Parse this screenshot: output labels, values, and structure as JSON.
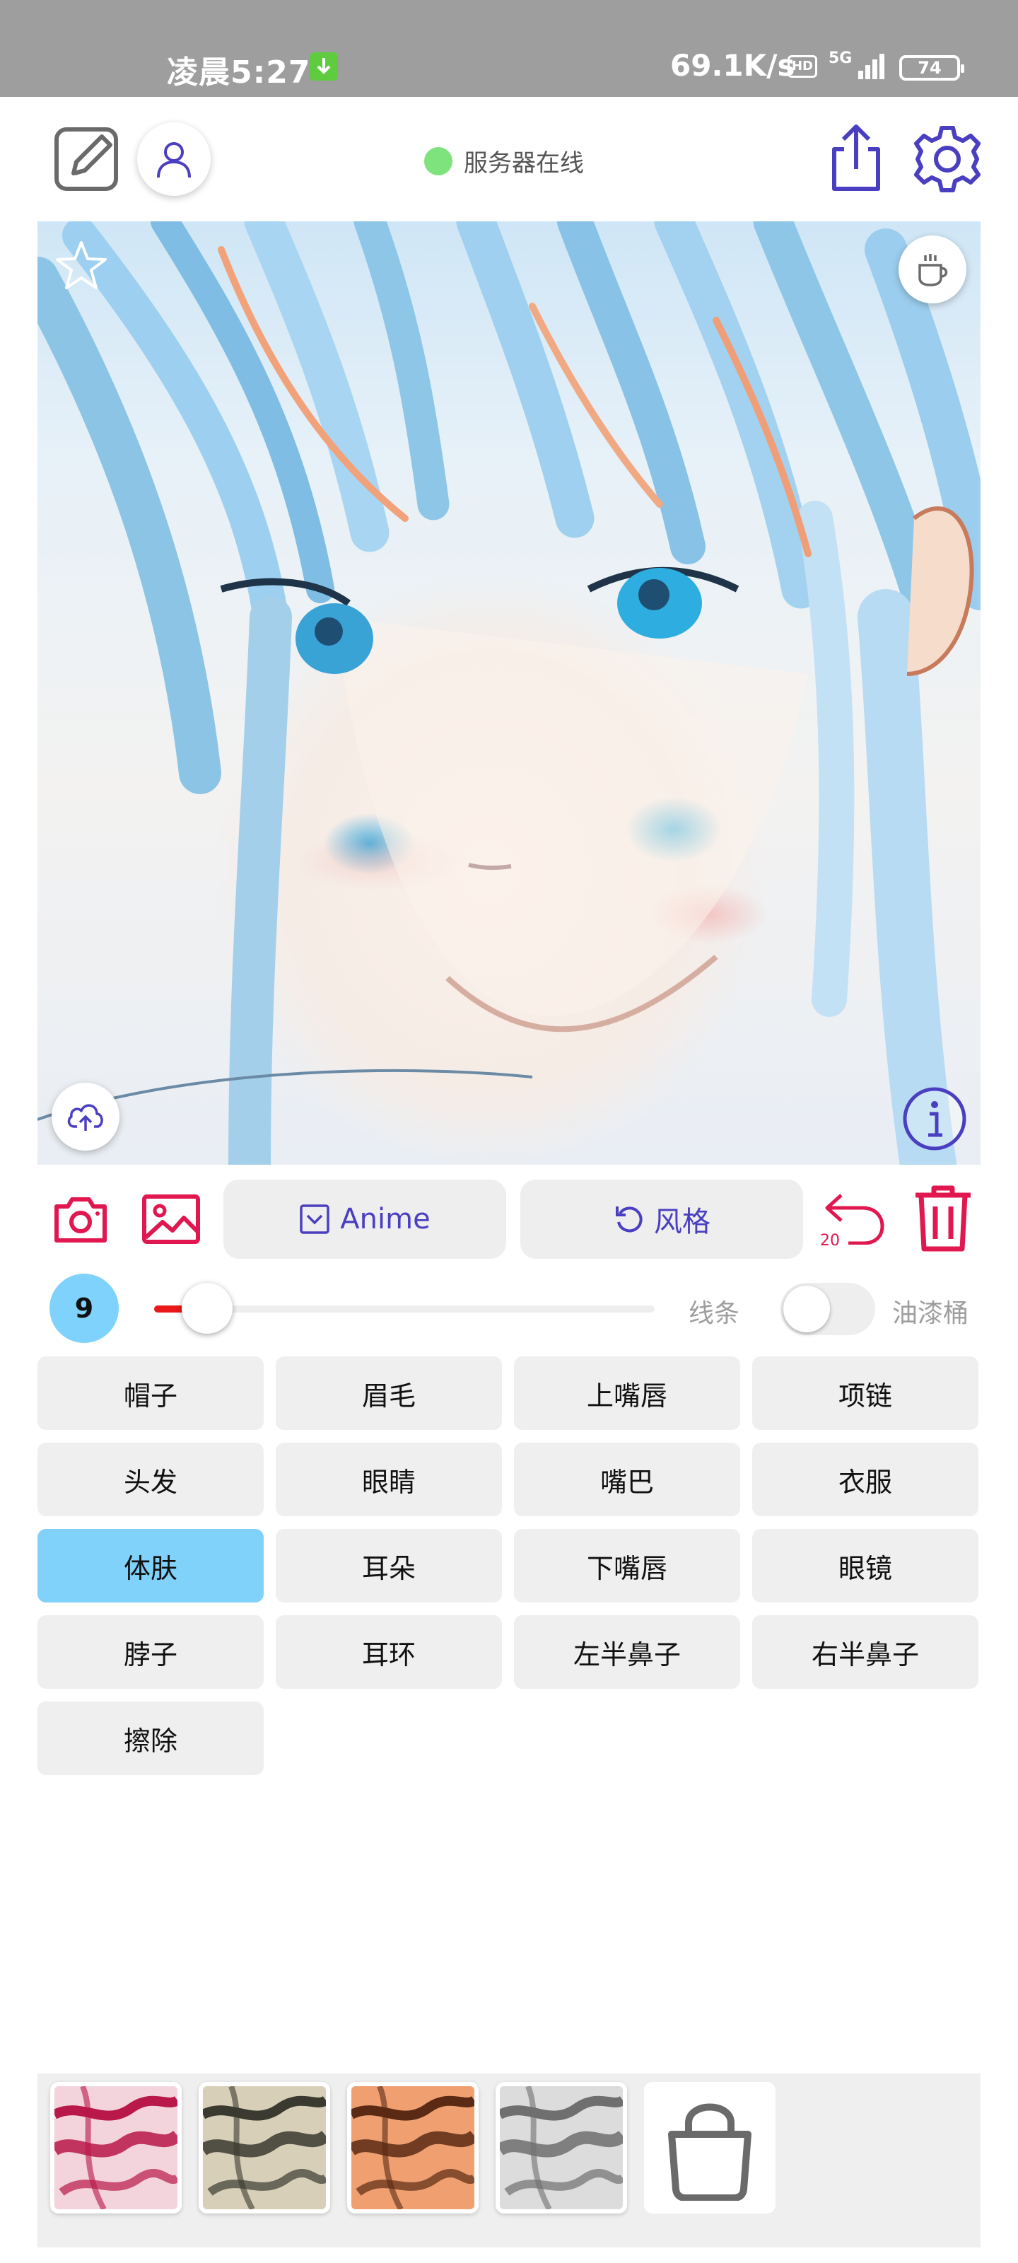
{
  "status_bar": {
    "time": "凌晨5:27",
    "speed": "69.1K/s",
    "hd_label": "HD",
    "network": "5G",
    "battery": "74"
  },
  "toolbar": {
    "icons": [
      "edit-icon",
      "user-icon",
      "share-icon",
      "gear-icon"
    ],
    "server_status": "服务器在线",
    "status_color": "#7ee37c",
    "accent_color": "#4a3fc0"
  },
  "canvas": {
    "icons": [
      "star-icon",
      "coffee-cup-icon",
      "upload-cloud-icon",
      "info-icon"
    ]
  },
  "actions": {
    "model_button_label": "Anime",
    "style_button_label": "风格",
    "undo_count": "20",
    "danger_color": "#e0184f"
  },
  "brush": {
    "size": "9",
    "size_level": 0.05,
    "line_label": "线条",
    "bucket_label": "油漆桶",
    "bucket_enabled": false
  },
  "parts": [
    {
      "label": "帽子",
      "active": false
    },
    {
      "label": "眉毛",
      "active": false
    },
    {
      "label": "上嘴唇",
      "active": false
    },
    {
      "label": "项链",
      "active": false
    },
    {
      "label": "头发",
      "active": false
    },
    {
      "label": "眼睛",
      "active": false
    },
    {
      "label": "嘴巴",
      "active": false
    },
    {
      "label": "衣服",
      "active": false
    },
    {
      "label": "体肤",
      "active": true
    },
    {
      "label": "耳朵",
      "active": false
    },
    {
      "label": "下嘴唇",
      "active": false
    },
    {
      "label": "眼镜",
      "active": false
    },
    {
      "label": "脖子",
      "active": false
    },
    {
      "label": "耳环",
      "active": false
    },
    {
      "label": "左半鼻子",
      "active": false
    },
    {
      "label": "右半鼻子",
      "active": false
    },
    {
      "label": "擦除",
      "active": false
    }
  ],
  "styles": [
    {
      "name": "style-1",
      "colors": [
        "#f3d3dc",
        "#b8184a"
      ]
    },
    {
      "name": "style-2",
      "colors": [
        "#d8cfb8",
        "#3b3a30"
      ]
    },
    {
      "name": "style-3",
      "colors": [
        "#f0a070",
        "#5a2a14"
      ]
    },
    {
      "name": "style-4",
      "colors": [
        "#dcdcdc",
        "#6f6f6f"
      ]
    }
  ],
  "shop_icon": "shopping-bag-icon"
}
